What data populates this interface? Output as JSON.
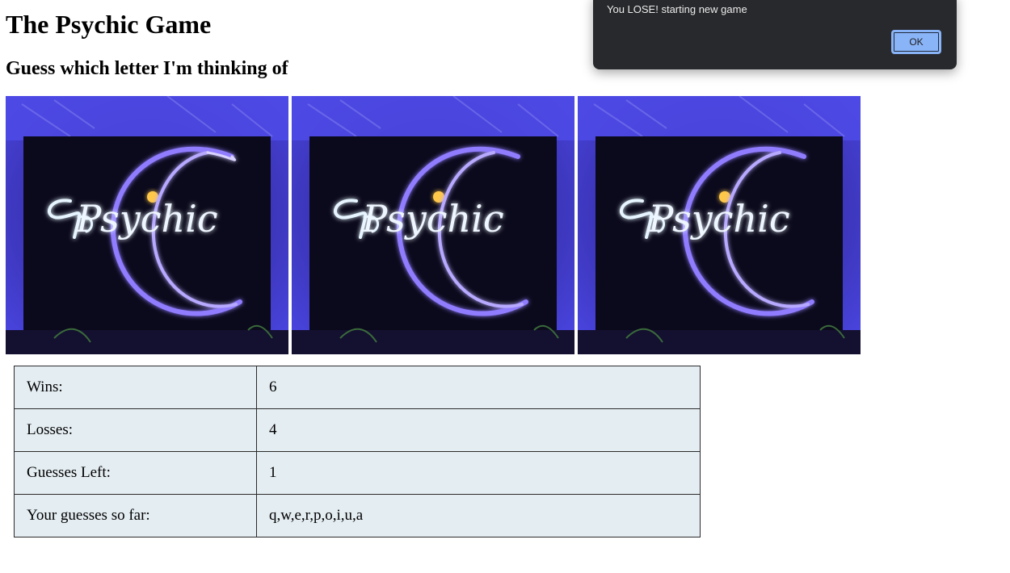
{
  "page": {
    "title": "The Psychic Game",
    "subtitle": "Guess which letter I'm thinking of"
  },
  "images": [
    {
      "sign_text": "Psychic"
    },
    {
      "sign_text": "Psychic"
    },
    {
      "sign_text": "Psychic"
    }
  ],
  "scoreboard": {
    "wins_label": "Wins:",
    "wins_value": "6",
    "losses_label": "Losses:",
    "losses_value": "4",
    "guesses_left_label": "Guesses Left:",
    "guesses_left_value": "1",
    "guesses_so_far_label": "Your guesses so far:",
    "guesses_so_far_value": "q,w,e,r,p,o,i,u,a"
  },
  "alert": {
    "message": "You LOSE! starting new game",
    "ok_label": "OK"
  },
  "colors": {
    "table_bg": "#e4edf2",
    "alert_bg": "#28292c",
    "ok_button": "#8ab4f8",
    "neon_purple": "#7b5cff",
    "neon_white": "#eef6ff"
  }
}
